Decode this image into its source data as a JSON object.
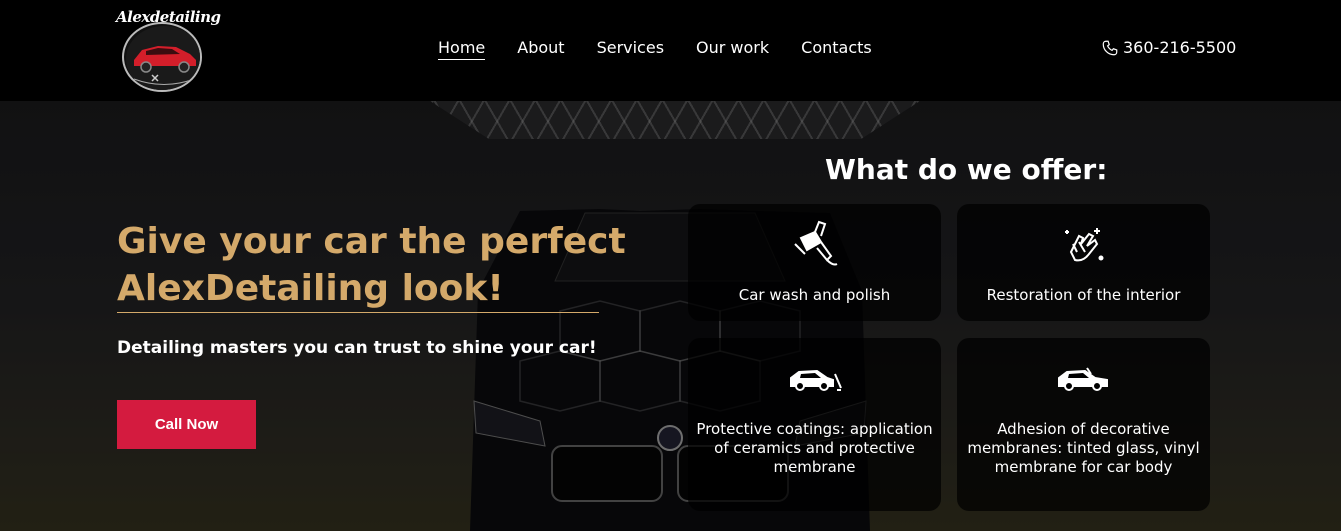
{
  "logo": {
    "text": "Alexdetailing"
  },
  "nav": {
    "items": [
      {
        "label": "Home",
        "active": true
      },
      {
        "label": "About",
        "active": false
      },
      {
        "label": "Services",
        "active": false
      },
      {
        "label": "Our work",
        "active": false
      },
      {
        "label": "Contacts",
        "active": false
      }
    ]
  },
  "phone": {
    "icon": "phone-icon",
    "number": "360-216-5500"
  },
  "hero": {
    "title_line1": "Give your car the perfect",
    "title_line2": "AlexDetailing look!",
    "subtitle": "Detailing masters you can trust to shine your car!",
    "cta_label": "Call Now"
  },
  "offers": {
    "title": "What do we offer:",
    "cards": [
      {
        "icon": "polisher-icon",
        "label": "Car wash and polish"
      },
      {
        "icon": "hand-sparkle-icon",
        "label": "Restoration of the interior"
      },
      {
        "icon": "car-coating-icon",
        "label": "Protective coatings: application of ceramics and protective membrane"
      },
      {
        "icon": "car-film-icon",
        "label": "Adhesion of decorative membranes: tinted glass, vinyl membrane for car body"
      }
    ]
  },
  "colors": {
    "accent_gold": "#d4a96a",
    "cta_red": "#d41b3f",
    "header_bg": "#000000"
  }
}
